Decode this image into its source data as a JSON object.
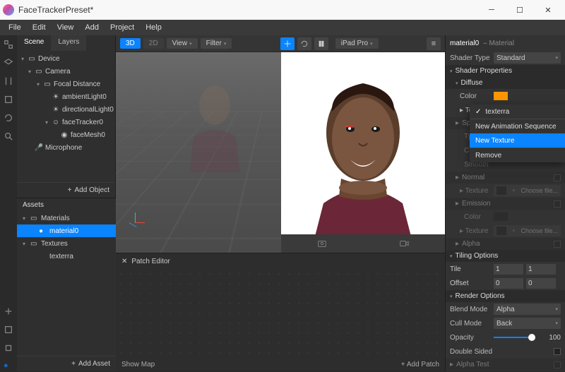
{
  "title": "FaceTrackerPreset*",
  "menus": [
    "File",
    "Edit",
    "View",
    "Add",
    "Project",
    "Help"
  ],
  "scene": {
    "tabs": [
      "Scene",
      "Layers"
    ],
    "tree": [
      {
        "d": 0,
        "arr": "▾",
        "icon": "device",
        "label": "Device"
      },
      {
        "d": 1,
        "arr": "▾",
        "icon": "camera",
        "label": "Camera"
      },
      {
        "d": 2,
        "arr": "▾",
        "icon": "focal",
        "label": "Focal Distance"
      },
      {
        "d": 3,
        "arr": "",
        "icon": "light",
        "label": "ambientLight0"
      },
      {
        "d": 3,
        "arr": "",
        "icon": "light",
        "label": "directionalLight0"
      },
      {
        "d": 3,
        "arr": "▾",
        "icon": "face",
        "label": "faceTracker0"
      },
      {
        "d": 4,
        "arr": "",
        "icon": "mesh",
        "label": "faceMesh0"
      },
      {
        "d": 1,
        "arr": "",
        "icon": "mic",
        "label": "Microphone"
      }
    ],
    "addObject": "Add Object"
  },
  "assets": {
    "header": "Assets",
    "items": [
      {
        "d": 0,
        "arr": "▾",
        "icon": "folder",
        "label": "Materials",
        "sel": false
      },
      {
        "d": 1,
        "arr": "",
        "icon": "mat",
        "label": "material0",
        "sel": true
      },
      {
        "d": 0,
        "arr": "▾",
        "icon": "folder",
        "label": "Textures",
        "sel": false
      },
      {
        "d": 1,
        "arr": "",
        "icon": "",
        "label": "texterra",
        "sel": false
      }
    ],
    "addAsset": "Add Asset"
  },
  "viewport": {
    "mode3d": "3D",
    "mode2d": "2D",
    "view": "View",
    "filter": "Filter",
    "device": "iPad Pro"
  },
  "patch": {
    "title": "Patch Editor",
    "showMap": "Show Map",
    "addPatch": "Add Patch"
  },
  "inspector": {
    "name": "material0",
    "type": "– Material",
    "shaderType": {
      "label": "Shader Type",
      "value": "Standard"
    },
    "sections": {
      "shaderProps": "Shader Properties",
      "diffuse": "Diffuse",
      "color": "Color",
      "texture": "Texture",
      "textureVal": "texterra",
      "specular": "Specular",
      "type": "Type",
      "smooth": "Smooth",
      "normal": "Normal",
      "emission": "Emission",
      "alpha": "Alpha",
      "tiling": "Tiling Options",
      "tile": "Tile",
      "offset": "Offset",
      "render": "Render Options",
      "blend": "Blend Mode",
      "blendVal": "Alpha",
      "cull": "Cull Mode",
      "cullVal": "Back",
      "opacity": "Opacity",
      "opacityVal": "100",
      "double": "Double Sided",
      "alphaTest": "Alpha Test",
      "chooseFile": "Choose file..."
    },
    "tile": [
      "1",
      "1"
    ],
    "offset": [
      "0",
      "0"
    ]
  },
  "dropdown": {
    "items": [
      {
        "label": "texterra",
        "chk": true
      },
      {
        "label": "New Animation Sequence"
      },
      {
        "label": "New Texture",
        "sel": true
      },
      {
        "label": "Remove"
      }
    ]
  }
}
